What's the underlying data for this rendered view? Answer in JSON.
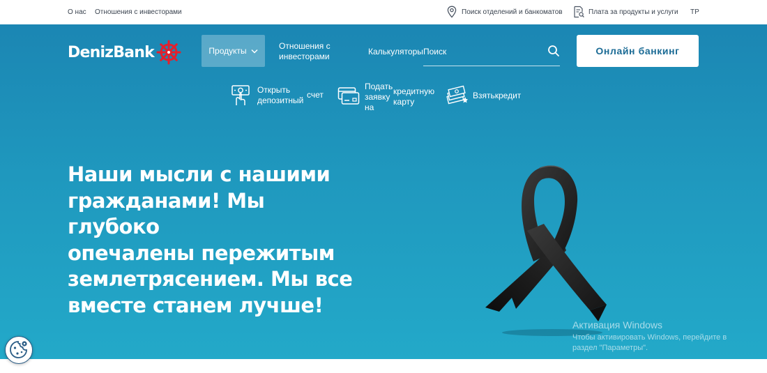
{
  "topbar": {
    "about": "О нас",
    "investors": "Отношения с инвесторами",
    "branch_search": "Поиск отделений и банкоматов",
    "payments": "Плата за продукты и услуги",
    "language": "TP"
  },
  "header": {
    "logo_text": "DenizBank",
    "products_label": "Продукты",
    "investors_label": "Отношения с инвесторами",
    "calculators_label": "Калькуляторы",
    "search_placeholder": "Поиск",
    "online_banking_label": "Онлайн банкинг"
  },
  "quick_links": {
    "deposit_line1": "Открыть",
    "deposit_line2": "депозитный",
    "deposit_side": "счет",
    "card_line1": "Подать",
    "card_line2": "заявку",
    "card_line3": "на",
    "card_side1": "кредитную",
    "card_side2": "карту",
    "credit_label": "Взятькредит"
  },
  "hero": {
    "headline_lines": [
      "Наши мысли с нашими",
      "гражданами! Мы глубоко",
      "опечалены пережитым",
      "землетрясением. Мы все",
      "вместе станем лучше!"
    ]
  },
  "watermark": {
    "title": "Активация Windows",
    "line1": "Чтобы активировать Windows, перейдите в",
    "line2": "раздел \"Параметры\"."
  },
  "colors": {
    "hero_top": "#1b86b3",
    "hero_bottom": "#23a9c9",
    "logo_red": "#e3202c",
    "button_text": "#1b6b95"
  }
}
